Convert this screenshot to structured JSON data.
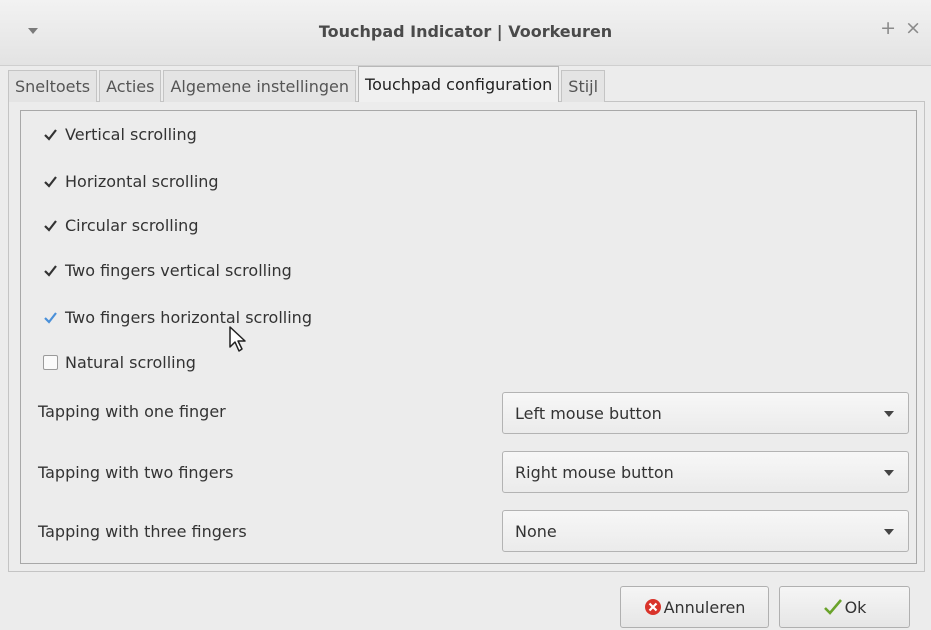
{
  "window": {
    "title": "Touchpad Indicator | Voorkeuren",
    "maximize_glyph": "+",
    "close_glyph": "×"
  },
  "tabs": [
    {
      "label": "Sneltoets",
      "active": false
    },
    {
      "label": "Acties",
      "active": false
    },
    {
      "label": "Algemene instellingen",
      "active": false
    },
    {
      "label": "Touchpad configuration",
      "active": true
    },
    {
      "label": "Stijl",
      "active": false
    }
  ],
  "checkboxes": [
    {
      "label": "Vertical scrolling",
      "checked": true
    },
    {
      "label": "Horizontal scrolling",
      "checked": true
    },
    {
      "label": "Circular scrolling",
      "checked": true
    },
    {
      "label": "Two fingers vertical scrolling",
      "checked": true
    },
    {
      "label": "Two fingers horizontal scrolling",
      "checked": true
    },
    {
      "label": "Natural scrolling",
      "checked": false
    }
  ],
  "tapping": [
    {
      "label": "Tapping with one finger",
      "value": "Left mouse button"
    },
    {
      "label": "Tapping with two fingers",
      "value": "Right mouse button"
    },
    {
      "label": "Tapping with three fingers",
      "value": "None"
    }
  ],
  "buttons": {
    "cancel_label": "Annuleren",
    "ok_label": "Ok"
  },
  "colors": {
    "accent": "#4a90d9",
    "cancel_icon": "#d9342b",
    "ok_icon": "#6aa32b"
  }
}
